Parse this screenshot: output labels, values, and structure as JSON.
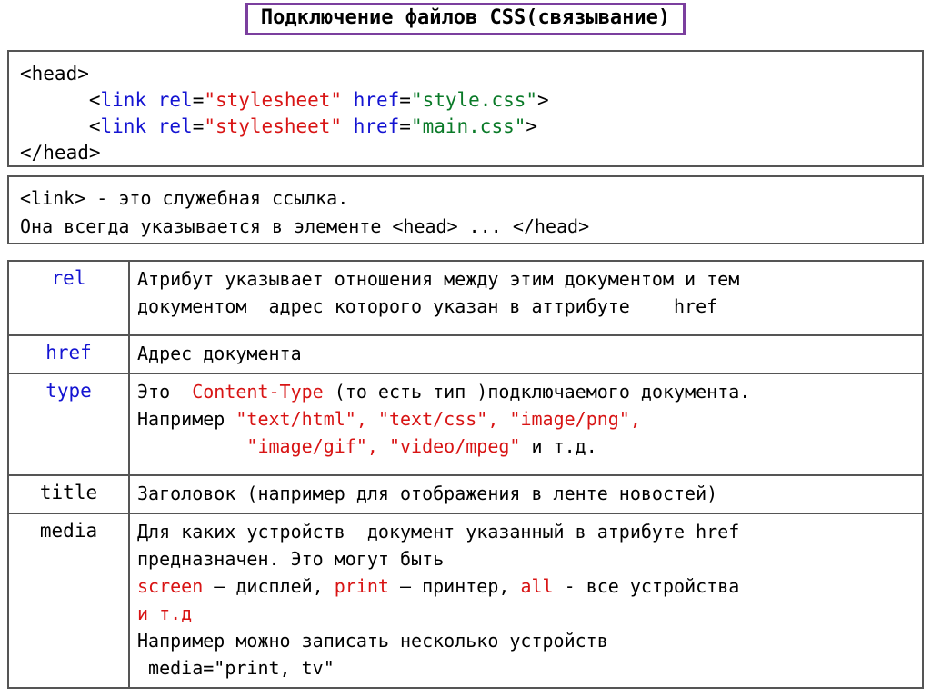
{
  "slide": {
    "title": "Подключение файлов CSS(связывание)",
    "title_border_color": "#7b3f9e",
    "background": "#ffffff"
  },
  "code_block": {
    "lines": [
      {
        "tokens": [
          {
            "text": "<head>",
            "color": "#000000",
            "role": "tag"
          }
        ]
      },
      {
        "tokens": [
          {
            "text": "      <",
            "color": "#000000",
            "role": "tag"
          },
          {
            "text": "link",
            "color": "#1414d2",
            "role": "element"
          },
          {
            "text": " ",
            "color": "#000000",
            "role": "space"
          },
          {
            "text": "rel",
            "color": "#1414d2",
            "role": "attribute"
          },
          {
            "text": "=",
            "color": "#000000",
            "role": "equals"
          },
          {
            "text": "\"stylesheet\"",
            "color": "#d81414",
            "role": "value"
          },
          {
            "text": " ",
            "color": "#000000",
            "role": "space"
          },
          {
            "text": "href",
            "color": "#1414d2",
            "role": "attribute"
          },
          {
            "text": "=",
            "color": "#000000",
            "role": "equals"
          },
          {
            "text": "\"style.css\"",
            "color": "#0a7a28",
            "role": "value"
          },
          {
            "text": ">",
            "color": "#000000",
            "role": "tag"
          }
        ]
      },
      {
        "tokens": [
          {
            "text": "      <",
            "color": "#000000",
            "role": "tag"
          },
          {
            "text": "link",
            "color": "#1414d2",
            "role": "element"
          },
          {
            "text": " ",
            "color": "#000000",
            "role": "space"
          },
          {
            "text": "rel",
            "color": "#1414d2",
            "role": "attribute"
          },
          {
            "text": "=",
            "color": "#000000",
            "role": "equals"
          },
          {
            "text": "\"stylesheet\"",
            "color": "#d81414",
            "role": "value"
          },
          {
            "text": " ",
            "color": "#000000",
            "role": "space"
          },
          {
            "text": "href",
            "color": "#1414d2",
            "role": "attribute"
          },
          {
            "text": "=",
            "color": "#000000",
            "role": "equals"
          },
          {
            "text": "\"main.css\"",
            "color": "#0a7a28",
            "role": "value"
          },
          {
            "text": ">",
            "color": "#000000",
            "role": "tag"
          }
        ]
      },
      {
        "tokens": [
          {
            "text": "</head>",
            "color": "#000000",
            "role": "tag"
          }
        ]
      }
    ]
  },
  "note_block": {
    "lines": [
      "<link> - это служебная ссылка.",
      "Она всегда указывается в элементе <head> ... </head>"
    ]
  },
  "attributes_table": {
    "rows": [
      {
        "key": "rel",
        "key_color": "#1414d2",
        "lines": [
          {
            "segments": [
              {
                "text": "Атрибут указывает отношения между этим документом и тем",
                "color": "#000000"
              }
            ]
          },
          {
            "segments": [
              {
                "text": "документом  адрес которого указан в аттрибуте    href",
                "color": "#000000"
              }
            ]
          }
        ]
      },
      {
        "key": "href",
        "key_color": "#1414d2",
        "lines": [
          {
            "segments": [
              {
                "text": "Адрес документа",
                "color": "#000000"
              }
            ]
          }
        ]
      },
      {
        "key": "type",
        "key_color": "#1414d2",
        "lines": [
          {
            "segments": [
              {
                "text": "Это  ",
                "color": "#000000"
              },
              {
                "text": "Content-Type",
                "color": "#d81414"
              },
              {
                "text": " (то есть тип )подключаемого документа.",
                "color": "#000000"
              }
            ]
          },
          {
            "segments": [
              {
                "text": "Например ",
                "color": "#000000"
              },
              {
                "text": "\"text/html\", \"text/css\", \"image/png\",",
                "color": "#d81414"
              }
            ]
          },
          {
            "segments": [
              {
                "text": "          ",
                "color": "#000000"
              },
              {
                "text": "\"image/gif\", \"video/mpeg\"",
                "color": "#d81414"
              },
              {
                "text": " и т.д.",
                "color": "#000000"
              }
            ]
          }
        ]
      },
      {
        "key": "title",
        "key_color": "#000000",
        "lines": [
          {
            "segments": [
              {
                "text": "Заголовок (например для отображения в ленте новостей)",
                "color": "#000000"
              }
            ]
          }
        ]
      },
      {
        "key": "media",
        "key_color": "#000000",
        "lines": [
          {
            "segments": [
              {
                "text": "Для каких устройств  документ указанный в атрибуте href",
                "color": "#000000"
              }
            ]
          },
          {
            "segments": [
              {
                "text": "предназначен. Это могут быть",
                "color": "#000000"
              }
            ]
          },
          {
            "segments": [
              {
                "text": "screen",
                "color": "#d81414"
              },
              {
                "text": " – дисплей, ",
                "color": "#000000"
              },
              {
                "text": "print",
                "color": "#d81414"
              },
              {
                "text": " – принтер, ",
                "color": "#000000"
              },
              {
                "text": "all",
                "color": "#d81414"
              },
              {
                "text": " - все устройства",
                "color": "#000000"
              }
            ]
          },
          {
            "segments": [
              {
                "text": "и т.д",
                "color": "#d81414"
              }
            ]
          },
          {
            "segments": [
              {
                "text": "Например можно записать несколько устройств",
                "color": "#000000"
              }
            ]
          },
          {
            "segments": [
              {
                "text": " media=\"print, tv\"",
                "color": "#000000"
              }
            ]
          }
        ]
      }
    ]
  }
}
